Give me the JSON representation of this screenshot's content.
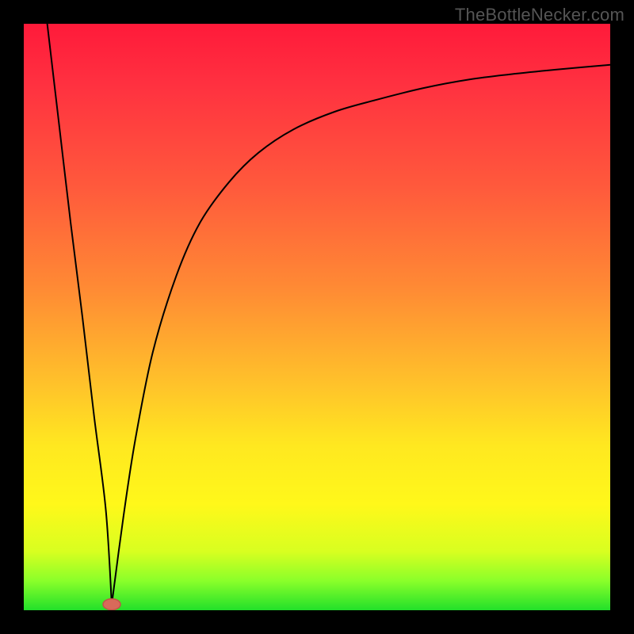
{
  "watermark": "TheBottleNecker.com",
  "chart_data": {
    "type": "line",
    "title": "",
    "xlabel": "",
    "ylabel": "",
    "xlim": [
      0,
      100
    ],
    "ylim": [
      0,
      100
    ],
    "notch_x": 15,
    "series": [
      {
        "name": "left-branch",
        "x": [
          4,
          6,
          8,
          10,
          12,
          14,
          15
        ],
        "values": [
          100,
          83,
          66,
          50,
          33,
          17,
          1
        ]
      },
      {
        "name": "right-branch",
        "x": [
          15,
          17,
          19,
          22,
          26,
          30,
          35,
          40,
          46,
          53,
          60,
          68,
          76,
          84,
          92,
          100
        ],
        "values": [
          1,
          16,
          29,
          44,
          57,
          66,
          73,
          78,
          82,
          85,
          87,
          89,
          90.5,
          91.5,
          92.3,
          93
        ]
      }
    ],
    "marker": {
      "x": 15,
      "y": 1,
      "color": "#d86a5a"
    },
    "colors": {
      "gradient_top": "#ff1a3a",
      "gradient_mid": "#ffe820",
      "gradient_bottom": "#22e02a",
      "curve": "#000000",
      "background": "#000000"
    }
  }
}
